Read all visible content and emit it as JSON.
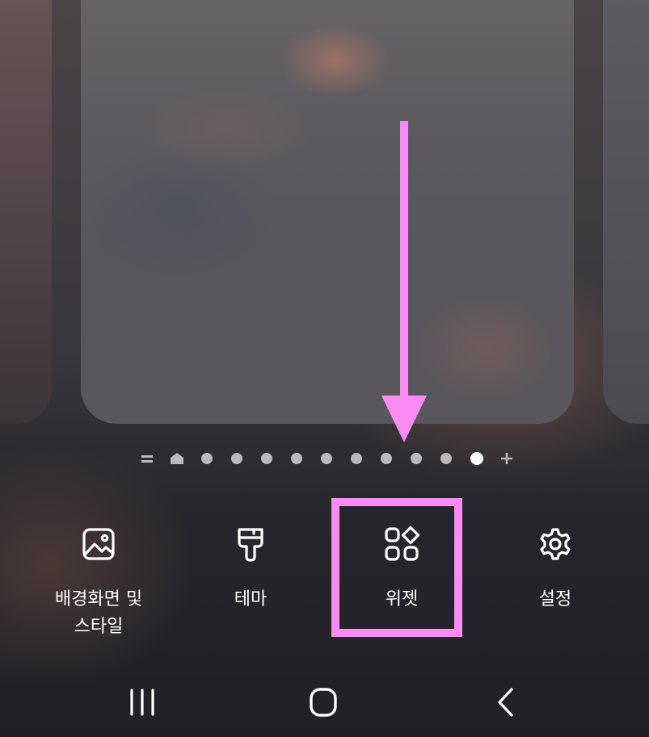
{
  "home_pages": {
    "page_count": 10,
    "active_page": 10,
    "indicators": [
      "menu-lines-icon",
      "home-icon",
      "dot",
      "dot",
      "dot",
      "dot",
      "dot",
      "dot",
      "dot",
      "dot",
      "dot",
      "dot-active",
      "plus-icon"
    ]
  },
  "bottom_menu": {
    "wallpaper_label": "배경화면 및\n스타일",
    "themes_label": "테마",
    "widgets_label": "위젯",
    "settings_label": "설정"
  },
  "nav_bar": {
    "recent_icon": "recent-apps-icon",
    "home_icon": "home-button-icon",
    "back_icon": "back-icon"
  },
  "annotation": {
    "color": "#f98bf2",
    "target": "widgets"
  }
}
